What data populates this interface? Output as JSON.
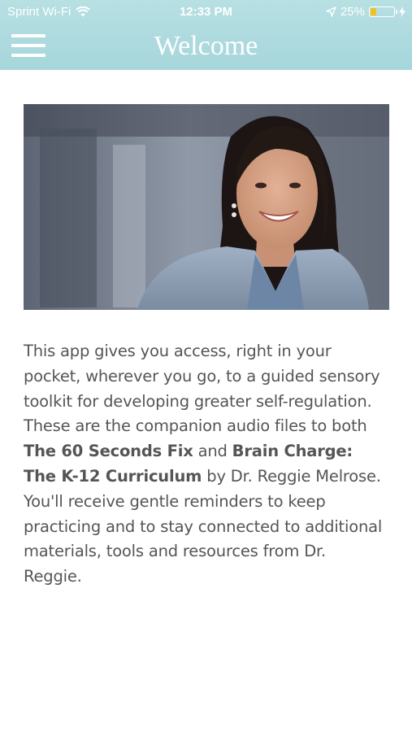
{
  "status_bar": {
    "carrier": "Sprint Wi-Fi",
    "time": "12:33 PM",
    "battery_percent": "25%",
    "battery_level": 0.25,
    "icons": [
      "wifi-icon",
      "location-arrow-icon",
      "battery-icon",
      "charging-bolt-icon"
    ]
  },
  "header": {
    "title": "Welcome",
    "menu_icon": "hamburger-menu-icon"
  },
  "colors": {
    "header_background": "#a9d8dc",
    "header_text": "#ffffff",
    "body_text": "#555555",
    "battery_fill": "#f3c21c"
  },
  "photo": {
    "alt": "portrait-photo"
  },
  "description": {
    "part1": "This app gives you access, right in your pocket, wherever you go, to a guided sensory toolkit for developing greater self-regulation. These are the companion audio files to both ",
    "bold1": "The 60 Seconds Fix",
    "part2": " and ",
    "bold2": "Brain Charge: The K-12 Curriculum",
    "part3": " by Dr. Reggie Melrose. You'll receive gentle reminders to keep practicing and to stay connected to additional materials, tools and resources from Dr. Reggie."
  }
}
